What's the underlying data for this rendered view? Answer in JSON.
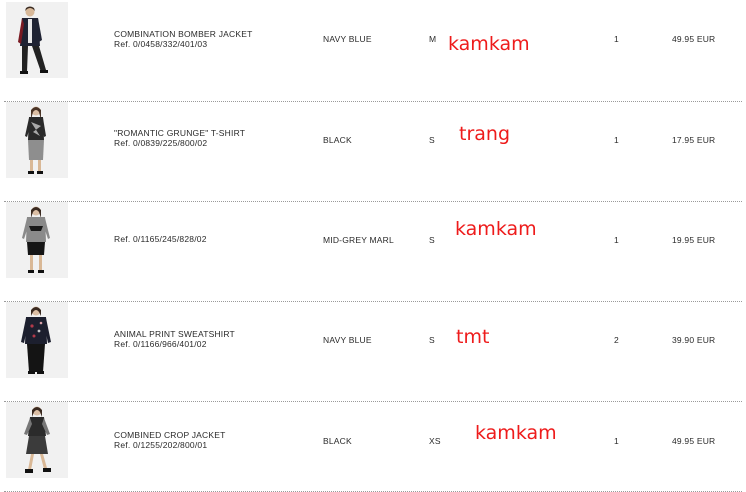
{
  "cart_items": [
    {
      "name": "COMBINATION BOMBER JACKET",
      "ref": "Ref. 0/0458/332/401/03",
      "color": "NAVY BLUE",
      "size": "M",
      "annotation": "kamkam",
      "quantity": "1",
      "price": "49.95 EUR"
    },
    {
      "name": "\"ROMANTIC GRUNGE\" T-SHIRT",
      "ref": "Ref. 0/0839/225/800/02",
      "color": "BLACK",
      "size": "S",
      "annotation": "trang",
      "quantity": "1",
      "price": "17.95 EUR"
    },
    {
      "name": "",
      "ref": "Ref. 0/1165/245/828/02",
      "color": "MID-GREY MARL",
      "size": "S",
      "annotation": "kamkam",
      "quantity": "1",
      "price": "19.95 EUR"
    },
    {
      "name": "ANIMAL PRINT SWEATSHIRT",
      "ref": "Ref. 0/1166/966/401/02",
      "color": "NAVY BLUE",
      "size": "S",
      "annotation": "tmt",
      "quantity": "2",
      "price": "39.90 EUR"
    },
    {
      "name": "COMBINED CROP JACKET",
      "ref": "Ref. 0/1255/202/800/01",
      "color": "BLACK",
      "size": "XS",
      "annotation": "kamkam",
      "quantity": "1",
      "price": "49.95 EUR"
    }
  ],
  "colors": {
    "annotation": "#ee1b1b",
    "text": "#2a2a2a",
    "divider": "#9a9a9a"
  }
}
